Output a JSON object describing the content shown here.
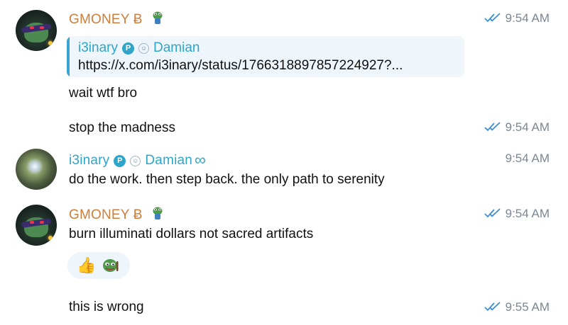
{
  "messages": [
    {
      "sender": "GMONEY Ƀ",
      "time": "9:54 AM",
      "reply": {
        "name": "i3inary",
        "badge": "P",
        "secondary_name": "Damian",
        "text": "https://x.com/i3inary/status/1766318897857224927?..."
      },
      "text": "wait wtf bro"
    },
    {
      "text": "stop the madness",
      "time": "9:54 AM"
    },
    {
      "sender": "i3inary",
      "badge": "P",
      "secondary_name": "Damian",
      "time": "9:54 AM",
      "text": "do the work.  then step back.  the only path to serenity"
    },
    {
      "sender": "GMONEY Ƀ",
      "time": "9:54 AM",
      "text": "burn illuminati dollars not sacred artifacts",
      "reactions": [
        "👍",
        "pepe-icon"
      ]
    },
    {
      "text": "this is wrong",
      "time": "9:55 AM"
    }
  ],
  "colors": {
    "gmoney_name": "#cf7d3a",
    "i3inary_name": "#2ea5c9",
    "read_check": "#3a8fd0",
    "time": "#7a8794",
    "reply_bg": "#eef5fb"
  }
}
